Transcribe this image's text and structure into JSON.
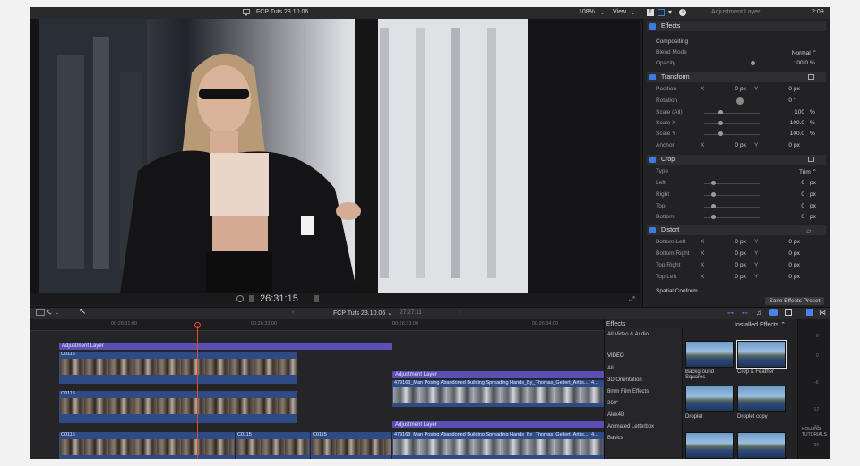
{
  "window": {
    "title": "FCP Tuts 23.10.06",
    "zoom": "108%",
    "view": "View"
  },
  "inspector": {
    "title": "Adjustment Layer",
    "duration": "2:09",
    "effects_label": "Effects",
    "compositing_label": "Compositing",
    "blend_mode": {
      "label": "Blend Mode",
      "value": "Normal ⌃"
    },
    "opacity": {
      "label": "Opacity",
      "value": "100.0",
      "unit": "%"
    },
    "transform_label": "Transform",
    "position": {
      "label": "Position",
      "x_label": "X",
      "x": "0",
      "x_unit": "px",
      "y_label": "Y",
      "y": "0",
      "y_unit": "px"
    },
    "rotation": {
      "label": "Rotation",
      "value": "0",
      "unit": "°"
    },
    "scale_all": {
      "label": "Scale (All)",
      "value": "100",
      "unit": "%"
    },
    "scale_x": {
      "label": "Scale X",
      "value": "100.0",
      "unit": "%"
    },
    "scale_y": {
      "label": "Scale Y",
      "value": "100.0",
      "unit": "%"
    },
    "anchor": {
      "label": "Anchor",
      "x_label": "X",
      "x": "0",
      "x_unit": "px",
      "y_label": "Y",
      "y": "0",
      "y_unit": "px"
    },
    "crop_label": "Crop",
    "crop_type": {
      "label": "Type",
      "value": "Trim ⌃"
    },
    "crop_left": {
      "label": "Left",
      "value": "0",
      "unit": "px"
    },
    "crop_right": {
      "label": "Right",
      "value": "0",
      "unit": "px"
    },
    "crop_top": {
      "label": "Top",
      "value": "0",
      "unit": "px"
    },
    "crop_bottom": {
      "label": "Bottom",
      "value": "0",
      "unit": "px"
    },
    "distort_label": "Distort",
    "bottom_left": {
      "label": "Bottom Left",
      "x_label": "X",
      "x": "0",
      "x_unit": "px",
      "y_label": "Y",
      "y": "0",
      "y_unit": "px"
    },
    "bottom_right": {
      "label": "Bottom Right",
      "x_label": "X",
      "x": "0",
      "x_unit": "px",
      "y_label": "Y",
      "y": "0",
      "y_unit": "px"
    },
    "top_right": {
      "label": "Top Right",
      "x_label": "X",
      "x": "0",
      "x_unit": "px",
      "y_label": "Y",
      "y": "0",
      "y_unit": "px"
    },
    "top_left": {
      "label": "Top Left",
      "x_label": "X",
      "x": "0",
      "x_unit": "px",
      "y_label": "Y",
      "y": "0",
      "y_unit": "px"
    },
    "spatial_conform_label": "Spatial Conform",
    "save_preset": "Save Effects Preset"
  },
  "viewer": {
    "timecode": "26:31:15"
  },
  "timeline": {
    "project": "FCP Tuts 23.10.06 ⌄",
    "duration": "27:27:11",
    "ruler": [
      "00:26:31:00",
      "00:26:32:00",
      "00:26:33:00",
      "00:26:34:00"
    ],
    "adjustment_layer_label": "Adjustment Layer",
    "clip_c0115": "C0115",
    "clip_man": "479163_Man Posing Abandoned Building Spreading Hands_By_Thomas_Gellert_Artlis...",
    "clip_suffix": "4..."
  },
  "effects_browser": {
    "title": "Effects",
    "installed": "Installed Effects ⌃",
    "categories": [
      "All Video & Audio",
      "VIDEO",
      "All",
      "3D Orientation",
      "8mm Film Effects",
      "360°",
      "Alex4D",
      "Animated Letterbox",
      "Basics"
    ],
    "items": [
      {
        "name": "Background Squares"
      },
      {
        "name": "Crop & Feather"
      },
      {
        "name": "Droplet"
      },
      {
        "name": "Droplet copy"
      }
    ]
  },
  "meter_labels": [
    "6",
    "0",
    "-6",
    "-12",
    "-20",
    "-30"
  ],
  "watermark": "KOLLINS TUTORIALS",
  "colors": {
    "accent": "#3d7be0",
    "adjustment": "#5a4fb4",
    "clip": "#2f4b86",
    "playhead": "#e04a2a"
  }
}
